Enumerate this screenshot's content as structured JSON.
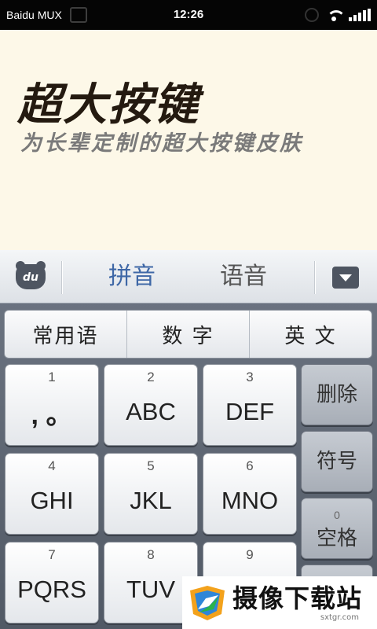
{
  "status_bar": {
    "carrier": "Baidu MUX",
    "time": "12:26"
  },
  "banner": {
    "title": "超大按键",
    "title_highlight_index": 2,
    "subtitle": "为长辈定制的超大按键皮肤",
    "background": "#fdf8e8"
  },
  "candidate_bar": {
    "logo_text": "du",
    "tabs": [
      {
        "label": "拼音",
        "active": true
      },
      {
        "label": "语音",
        "active": false
      }
    ]
  },
  "mode_row": [
    {
      "label": "常用语"
    },
    {
      "label": "数 字"
    },
    {
      "label": "英 文"
    }
  ],
  "keys": [
    {
      "num": "1",
      "letters": ", 。"
    },
    {
      "num": "2",
      "letters": "ABC"
    },
    {
      "num": "3",
      "letters": "DEF"
    },
    {
      "num": "4",
      "letters": "GHI"
    },
    {
      "num": "5",
      "letters": "JKL"
    },
    {
      "num": "6",
      "letters": "MNO"
    },
    {
      "num": "7",
      "letters": "PQRS"
    },
    {
      "num": "8",
      "letters": "TUV"
    },
    {
      "num": "9",
      "letters": ""
    }
  ],
  "function_keys": {
    "delete": "删除",
    "symbol": "符号",
    "space_num": "0",
    "space": "空格"
  },
  "watermark": {
    "name": "摄像下载站",
    "url": "sxtgr.com"
  },
  "colors": {
    "accent": "#3e67a6",
    "keyboard_bg": "#5f6773"
  }
}
